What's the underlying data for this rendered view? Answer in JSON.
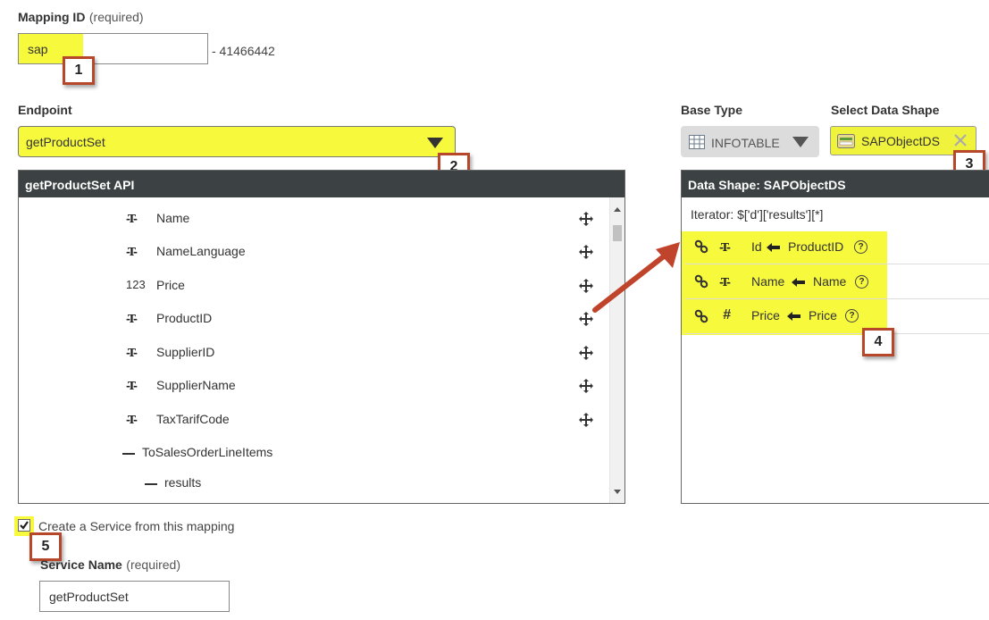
{
  "mapping": {
    "label": "Mapping ID",
    "required": "(required)",
    "value": "sap",
    "suffix": "- 41466442"
  },
  "endpoint": {
    "label": "Endpoint",
    "value": "getProductSet"
  },
  "api_panel": {
    "title": "getProductSet API",
    "fields": [
      {
        "type": "-T-",
        "name": "Name"
      },
      {
        "type": "-T-",
        "name": "NameLanguage"
      },
      {
        "type": "123",
        "name": "Price"
      },
      {
        "type": "-T-",
        "name": "ProductID"
      },
      {
        "type": "-T-",
        "name": "SupplierID"
      },
      {
        "type": "-T-",
        "name": "SupplierName"
      },
      {
        "type": "-T-",
        "name": "TaxTarifCode"
      }
    ],
    "collections": [
      {
        "name": "ToSalesOrderLineItems"
      },
      {
        "name": "results"
      }
    ]
  },
  "base_type": {
    "label": "Base Type",
    "value": "INFOTABLE"
  },
  "data_shape_select": {
    "label": "Select Data Shape",
    "value": "SAPObjectDS"
  },
  "data_shape_panel": {
    "title": "Data Shape: SAPObjectDS",
    "iterator": "Iterator: $['d']['results'][*]",
    "mappings": [
      {
        "type": "-T-",
        "target": "Id",
        "source": "ProductID"
      },
      {
        "type": "-T-",
        "target": "Name",
        "source": "Name"
      },
      {
        "type": "#",
        "target": "Price",
        "source": "Price"
      }
    ]
  },
  "badges": [
    "1",
    "2",
    "3",
    "4",
    "5"
  ],
  "service": {
    "checkbox_label": "Create a Service from this mapping",
    "checked": true,
    "name_label": "Service Name",
    "required": "(required)",
    "name_value": "getProductSet"
  },
  "colors": {
    "highlight": "#f7f93c",
    "panel_header": "#3c4244",
    "callout_border": "#b7472a",
    "arrow": "#c0442b"
  }
}
